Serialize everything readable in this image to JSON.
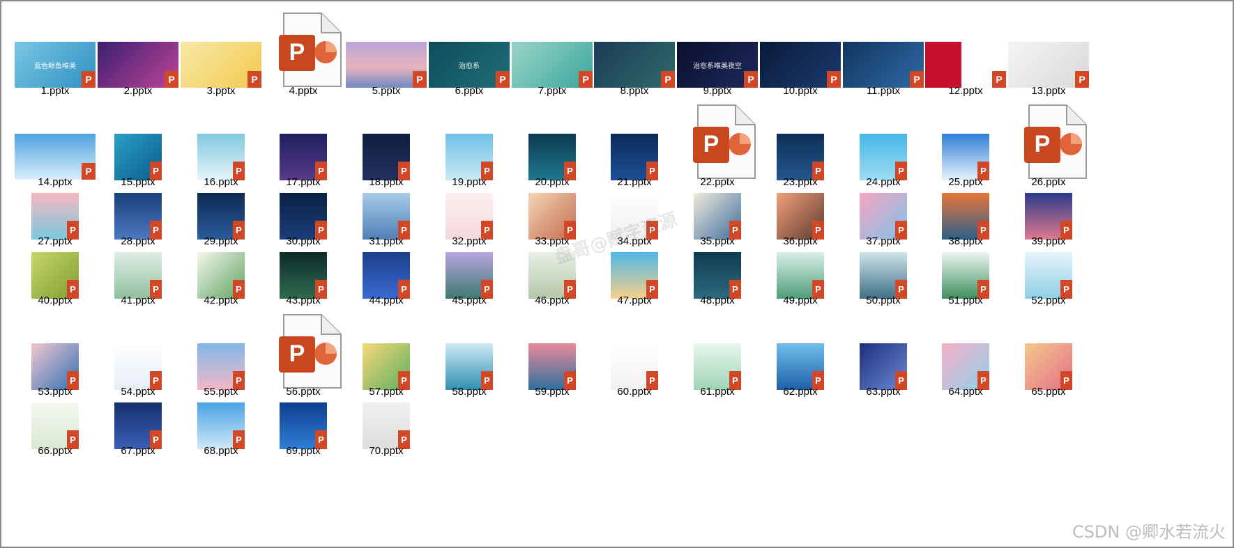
{
  "view": {
    "items": [
      {
        "label": "1.pptx",
        "thumb": "wide",
        "bg": "linear-gradient(135deg,#7ac7e4,#2e8fc2)",
        "caption": "蓝色鲸鱼唯美"
      },
      {
        "label": "2.pptx",
        "thumb": "wide",
        "bg": "linear-gradient(135deg,#3a1f6e,#c0449a)",
        "caption": ""
      },
      {
        "label": "3.pptx",
        "thumb": "wide",
        "bg": "linear-gradient(135deg,#f7e8a8,#f2c94c)",
        "caption": ""
      },
      {
        "label": "4.pptx",
        "thumb": "generic",
        "bg": "",
        "caption": ""
      },
      {
        "label": "5.pptx",
        "thumb": "wide",
        "bg": "linear-gradient(180deg,#b9a6d9,#e7b3c0 55%,#6f8ac0)",
        "caption": ""
      },
      {
        "label": "6.pptx",
        "thumb": "wide",
        "bg": "linear-gradient(135deg,#0f4c5c,#1f6f78)",
        "caption": "治愈系"
      },
      {
        "label": "7.pptx",
        "thumb": "wide",
        "bg": "linear-gradient(135deg,#9ad3c8,#3aa79b)",
        "caption": ""
      },
      {
        "label": "8.pptx",
        "thumb": "wide",
        "bg": "linear-gradient(135deg,#1c3b57,#2f6b6b)",
        "caption": ""
      },
      {
        "label": "9.pptx",
        "thumb": "wide",
        "bg": "linear-gradient(135deg,#0b0f2e,#1d2a5c)",
        "caption": "治愈系唯美夜空"
      },
      {
        "label": "10.pptx",
        "thumb": "wide",
        "bg": "linear-gradient(135deg,#0a1a3a,#1b3b6f)",
        "caption": ""
      },
      {
        "label": "11.pptx",
        "thumb": "wide",
        "bg": "linear-gradient(135deg,#12355e,#2e6aa6)",
        "caption": ""
      },
      {
        "label": "12.pptx",
        "thumb": "wide",
        "bg": "linear-gradient(90deg,#c8102e 45%,#ffffff 45%)",
        "caption": ""
      },
      {
        "label": "13.pptx",
        "thumb": "wide",
        "bg": "linear-gradient(135deg,#f4f4f4,#d9d9d9)",
        "caption": ""
      },
      {
        "label": "14.pptx",
        "thumb": "wide",
        "bg": "linear-gradient(180deg,#4fa3e0,#d9eefb)",
        "caption": ""
      },
      {
        "label": "15.pptx",
        "thumb": "sq",
        "bg": "linear-gradient(135deg,#2aa0c9,#0c5b8a)",
        "caption": ""
      },
      {
        "label": "16.pptx",
        "thumb": "sq",
        "bg": "linear-gradient(180deg,#7fc8de,#e8f6fb)",
        "caption": ""
      },
      {
        "label": "17.pptx",
        "thumb": "sq",
        "bg": "linear-gradient(180deg,#1d1f5e,#5a3b8a)",
        "caption": ""
      },
      {
        "label": "18.pptx",
        "thumb": "sq",
        "bg": "linear-gradient(180deg,#0f1c3f,#24305e)",
        "caption": ""
      },
      {
        "label": "19.pptx",
        "thumb": "sq",
        "bg": "linear-gradient(180deg,#6fc1e8,#cbe9f6)",
        "caption": ""
      },
      {
        "label": "20.pptx",
        "thumb": "sq",
        "bg": "linear-gradient(180deg,#0c3a4f,#1f7891)",
        "caption": ""
      },
      {
        "label": "21.pptx",
        "thumb": "sq",
        "bg": "linear-gradient(180deg,#0b2a5a,#1e4f96)",
        "caption": ""
      },
      {
        "label": "22.pptx",
        "thumb": "generic",
        "bg": "",
        "caption": ""
      },
      {
        "label": "23.pptx",
        "thumb": "sq",
        "bg": "linear-gradient(180deg,#0e2f56,#24568d)",
        "caption": ""
      },
      {
        "label": "24.pptx",
        "thumb": "sq",
        "bg": "linear-gradient(180deg,#45b8e6,#9fdcf3)",
        "caption": ""
      },
      {
        "label": "25.pptx",
        "thumb": "sq",
        "bg": "linear-gradient(180deg,#2f7fd6,#e9f3fc)",
        "caption": ""
      },
      {
        "label": "26.pptx",
        "thumb": "generic",
        "bg": "",
        "caption": ""
      },
      {
        "label": "27.pptx",
        "thumb": "sq",
        "bg": "linear-gradient(180deg,#f7b6c0,#7ac8e0)",
        "caption": ""
      },
      {
        "label": "28.pptx",
        "thumb": "sq",
        "bg": "linear-gradient(180deg,#1a3f7a,#4d79c2)",
        "caption": ""
      },
      {
        "label": "29.pptx",
        "thumb": "sq",
        "bg": "linear-gradient(180deg,#0e2a52,#2a5c9c)",
        "caption": ""
      },
      {
        "label": "30.pptx",
        "thumb": "sq",
        "bg": "linear-gradient(180deg,#0a1f44,#1c3f7a)",
        "caption": ""
      },
      {
        "label": "31.pptx",
        "thumb": "sq",
        "bg": "linear-gradient(180deg,#a9cbe8,#4f7fb6)",
        "caption": ""
      },
      {
        "label": "32.pptx",
        "thumb": "sq",
        "bg": "linear-gradient(180deg,#fbeff0,#f6d7dc)",
        "caption": ""
      },
      {
        "label": "33.pptx",
        "thumb": "sq",
        "bg": "linear-gradient(135deg,#f2d6b5,#c46b4f)",
        "caption": ""
      },
      {
        "label": "34.pptx",
        "thumb": "sq",
        "bg": "linear-gradient(180deg,#ffffff,#eeeeee)",
        "caption": ""
      },
      {
        "label": "35.pptx",
        "thumb": "sq",
        "bg": "linear-gradient(135deg,#f1eadb,#3c6e9e)",
        "caption": ""
      },
      {
        "label": "36.pptx",
        "thumb": "sq",
        "bg": "linear-gradient(135deg,#f3a07a,#5b3b2f)",
        "caption": ""
      },
      {
        "label": "37.pptx",
        "thumb": "sq",
        "bg": "linear-gradient(135deg,#f6a5c0,#7fc1ea)",
        "caption": ""
      },
      {
        "label": "38.pptx",
        "thumb": "sq",
        "bg": "linear-gradient(180deg,#e8763a,#2b5f8a)",
        "caption": ""
      },
      {
        "label": "39.pptx",
        "thumb": "sq",
        "bg": "linear-gradient(180deg,#2b3a8a,#e07a8f)",
        "caption": ""
      },
      {
        "label": "40.pptx",
        "thumb": "sq",
        "bg": "linear-gradient(135deg,#c7d66a,#7f9e2e)",
        "caption": ""
      },
      {
        "label": "41.pptx",
        "thumb": "sq",
        "bg": "linear-gradient(180deg,#dfeee6,#8fbf9e)",
        "caption": ""
      },
      {
        "label": "42.pptx",
        "thumb": "sq",
        "bg": "linear-gradient(135deg,#f4f7ee,#5fa35f)",
        "caption": ""
      },
      {
        "label": "43.pptx",
        "thumb": "sq",
        "bg": "linear-gradient(180deg,#0d2b2b,#2f6b4f)",
        "caption": ""
      },
      {
        "label": "44.pptx",
        "thumb": "sq",
        "bg": "linear-gradient(180deg,#1d3f8a,#3a6ad1)",
        "caption": ""
      },
      {
        "label": "45.pptx",
        "thumb": "sq",
        "bg": "linear-gradient(180deg,#b7a6e0,#3e7a6e)",
        "caption": ""
      },
      {
        "label": "46.pptx",
        "thumb": "sq",
        "bg": "linear-gradient(180deg,#e9efe6,#b4c7a8)",
        "caption": ""
      },
      {
        "label": "47.pptx",
        "thumb": "sq",
        "bg": "linear-gradient(180deg,#4fb8e6,#f7d08a)",
        "caption": ""
      },
      {
        "label": "48.pptx",
        "thumb": "sq",
        "bg": "linear-gradient(180deg,#0f3b4f,#2c6a80)",
        "caption": ""
      },
      {
        "label": "49.pptx",
        "thumb": "sq",
        "bg": "linear-gradient(180deg,#d9efe8,#4f9e7a)",
        "caption": ""
      },
      {
        "label": "50.pptx",
        "thumb": "sq",
        "bg": "linear-gradient(180deg,#cfe4ea,#3e6f86)",
        "caption": ""
      },
      {
        "label": "51.pptx",
        "thumb": "sq",
        "bg": "linear-gradient(180deg,#eef6f2,#3f8f5f)",
        "caption": ""
      },
      {
        "label": "52.pptx",
        "thumb": "sq",
        "bg": "linear-gradient(180deg,#e6f4fb,#8fcfe6)",
        "caption": ""
      },
      {
        "label": "53.pptx",
        "thumb": "sq",
        "bg": "linear-gradient(135deg,#f3c7d0,#2f6fb6)",
        "caption": ""
      },
      {
        "label": "54.pptx",
        "thumb": "sq",
        "bg": "linear-gradient(180deg,#ffffff,#e6eef6)",
        "caption": ""
      },
      {
        "label": "55.pptx",
        "thumb": "sq",
        "bg": "linear-gradient(180deg,#7fb8e8,#f4b7c7)",
        "caption": ""
      },
      {
        "label": "56.pptx",
        "thumb": "generic",
        "bg": "",
        "caption": ""
      },
      {
        "label": "57.pptx",
        "thumb": "sq",
        "bg": "linear-gradient(135deg,#f6d97a,#5fae5f)",
        "caption": ""
      },
      {
        "label": "58.pptx",
        "thumb": "sq",
        "bg": "linear-gradient(180deg,#cfeaf4,#2e8fb0)",
        "caption": ""
      },
      {
        "label": "59.pptx",
        "thumb": "sq",
        "bg": "linear-gradient(180deg,#e98a9a,#2f6f9e)",
        "caption": ""
      },
      {
        "label": "60.pptx",
        "thumb": "sq",
        "bg": "linear-gradient(180deg,#ffffff,#f1f1f1)",
        "caption": ""
      },
      {
        "label": "61.pptx",
        "thumb": "sq",
        "bg": "linear-gradient(180deg,#e8f6ee,#9fd4b4)",
        "caption": ""
      },
      {
        "label": "62.pptx",
        "thumb": "sq",
        "bg": "linear-gradient(180deg,#6fc0ea,#1f5fa8)",
        "caption": ""
      },
      {
        "label": "63.pptx",
        "thumb": "sq",
        "bg": "linear-gradient(135deg,#1d2f7a,#6b8ad6)",
        "caption": ""
      },
      {
        "label": "64.pptx",
        "thumb": "sq",
        "bg": "linear-gradient(135deg,#f6b0c8,#8fd0e8)",
        "caption": ""
      },
      {
        "label": "65.pptx",
        "thumb": "sq",
        "bg": "linear-gradient(135deg,#f3c98a,#e56f8a)",
        "caption": ""
      },
      {
        "label": "66.pptx",
        "thumb": "sq",
        "bg": "linear-gradient(180deg,#f6f9f2,#d8e8cf)",
        "caption": ""
      },
      {
        "label": "67.pptx",
        "thumb": "sq",
        "bg": "linear-gradient(180deg,#16306e,#3a5fb6)",
        "caption": ""
      },
      {
        "label": "68.pptx",
        "thumb": "sq",
        "bg": "linear-gradient(180deg,#4aa3e6,#cfe9f8)",
        "caption": ""
      },
      {
        "label": "69.pptx",
        "thumb": "sq",
        "bg": "linear-gradient(180deg,#0f3f8f,#2f7fd6)",
        "caption": ""
      },
      {
        "label": "70.pptx",
        "thumb": "sq",
        "bg": "linear-gradient(180deg,#f1f1f1,#dddddd)",
        "caption": ""
      }
    ]
  },
  "overlay": {
    "watermark": "盘哥@赋字资源",
    "footer": "CSDN @卿水若流火"
  },
  "icons": {
    "file_badge_letter": "P",
    "badge_color": "#d24726"
  }
}
